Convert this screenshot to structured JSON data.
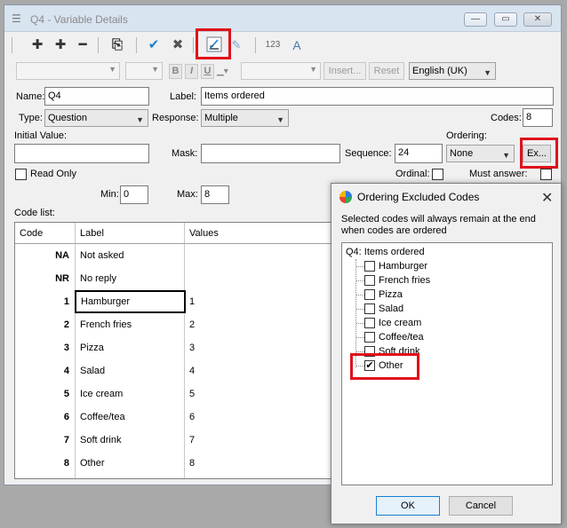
{
  "window": {
    "title": "Q4 - Variable Details",
    "title_icon": "variable-list-icon",
    "controls": {
      "minimize": "—",
      "maximize": "▭",
      "close": "✕"
    }
  },
  "toolbar": {
    "icons": [
      "plus-icon",
      "plus-bold-icon",
      "minus-icon",
      "import-icon",
      "check-icon",
      "cross-icon",
      "ordering-icon",
      "spell-check-icon",
      "number-format-icon",
      "auto-fit-icon"
    ],
    "glyphs": {
      "add": "✚",
      "add_bold": "✚",
      "remove": "━",
      "import": "⎘",
      "check": "✔",
      "cross": "✖",
      "numbering": "123",
      "autotext": "A"
    }
  },
  "formatbar": {
    "bold": "B",
    "italic": "I",
    "underline": "U",
    "insert_label": "Insert...",
    "reset_label": "Reset",
    "language": "English (UK)"
  },
  "form": {
    "name_label": "Name:",
    "name_value": "Q4",
    "label_label": "Label:",
    "label_value": "Items ordered",
    "type_label": "Type:",
    "type_value": "Question",
    "response_label": "Response:",
    "response_value": "Multiple",
    "codes_label": "Codes:",
    "codes_value": "8",
    "initial_value_label": "Initial Value:",
    "mask_label": "Mask:",
    "sequence_label": "Sequence:",
    "sequence_value": "24",
    "ordering_label": "Ordering:",
    "ordering_value": "None",
    "excluded_button": "Ex...",
    "read_only_label": "Read Only",
    "ordinal_label": "Ordinal:",
    "must_answer_label": "Must answer:",
    "min_label": "Min:",
    "min_value": "0",
    "max_label": "Max:",
    "max_value": "8",
    "code_list_label": "Code list:"
  },
  "code_list": {
    "headers": [
      "Code",
      "Label",
      "Values"
    ],
    "rows": [
      {
        "code": "NA",
        "label": "Not asked",
        "value": ""
      },
      {
        "code": "NR",
        "label": "No reply",
        "value": ""
      },
      {
        "code": "1",
        "label": "Hamburger",
        "value": "1"
      },
      {
        "code": "2",
        "label": "French fries",
        "value": "2"
      },
      {
        "code": "3",
        "label": "Pizza",
        "value": "3"
      },
      {
        "code": "4",
        "label": "Salad",
        "value": "4"
      },
      {
        "code": "5",
        "label": "Ice cream",
        "value": "5"
      },
      {
        "code": "6",
        "label": "Coffee/tea",
        "value": "6"
      },
      {
        "code": "7",
        "label": "Soft drink",
        "value": "7"
      },
      {
        "code": "8",
        "label": "Other",
        "value": "8"
      }
    ]
  },
  "dialog": {
    "title": "Ordering Excluded Codes",
    "close": "✕",
    "description": "Selected codes will always remain at the end when codes are ordered",
    "tree_root": "Q4: Items ordered",
    "items": [
      {
        "label": "Hamburger",
        "checked": false
      },
      {
        "label": "French fries",
        "checked": false
      },
      {
        "label": "Pizza",
        "checked": false
      },
      {
        "label": "Salad",
        "checked": false
      },
      {
        "label": "Ice cream",
        "checked": false
      },
      {
        "label": "Coffee/tea",
        "checked": false
      },
      {
        "label": "Soft drink",
        "checked": false
      },
      {
        "label": "Other",
        "checked": true
      }
    ],
    "check_glyph": "✔",
    "ok_label": "OK",
    "cancel_label": "Cancel"
  },
  "colors": {
    "highlight": "#e0101a",
    "title_bar": "#d9e4f1",
    "check_blue": "#1a7fd1"
  }
}
